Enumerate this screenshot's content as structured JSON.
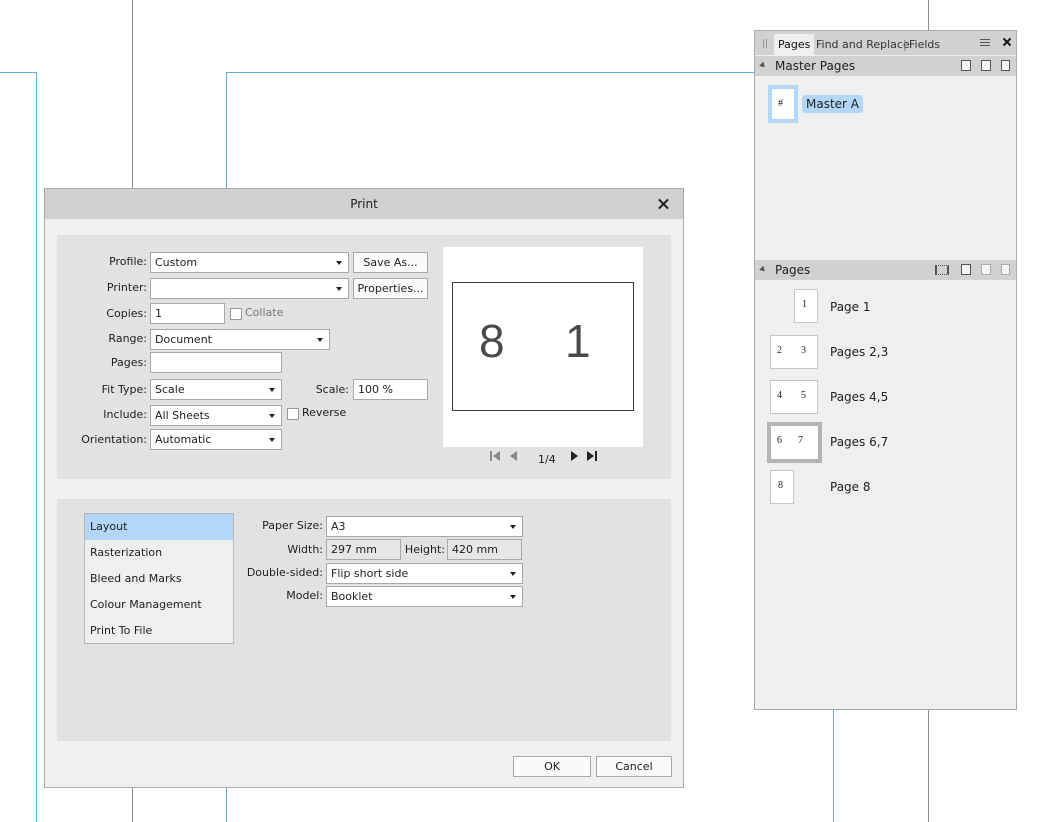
{
  "dialog": {
    "title": "Print",
    "profile": {
      "label": "Profile:",
      "value": "Custom",
      "save_as": "Save As..."
    },
    "printer": {
      "label": "Printer:",
      "value": "",
      "properties": "Properties..."
    },
    "copies": {
      "label": "Copies:",
      "value": "1",
      "collate_label": "Collate"
    },
    "range": {
      "label": "Range:",
      "value": "Document"
    },
    "pages": {
      "label": "Pages:",
      "value": ""
    },
    "fit_type": {
      "label": "Fit Type:",
      "value": "Scale"
    },
    "scale": {
      "label": "Scale:",
      "value": "100 %"
    },
    "include": {
      "label": "Include:",
      "value": "All Sheets",
      "reverse_label": "Reverse"
    },
    "orientation": {
      "label": "Orientation:",
      "value": "Automatic"
    },
    "preview": {
      "left_number": "8",
      "right_number": "1",
      "page_indicator": "1/4"
    },
    "categories": [
      "Layout",
      "Rasterization",
      "Bleed and Marks",
      "Colour Management",
      "Print To File"
    ],
    "paper_size": {
      "label": "Paper Size:",
      "value": "A3"
    },
    "width": {
      "label": "Width:",
      "value": "297 mm"
    },
    "height": {
      "label": "Height:",
      "value": "420 mm"
    },
    "double_sided": {
      "label": "Double-sided:",
      "value": "Flip short side"
    },
    "model": {
      "label": "Model:",
      "value": "Booklet"
    },
    "ok": "OK",
    "cancel": "Cancel"
  },
  "panel": {
    "tabs": [
      "Pages",
      "Find and Replace",
      "Fields"
    ],
    "tab_separator": "|",
    "master_pages_title": "Master Pages",
    "master": {
      "thumb": "#",
      "label": "Master A"
    },
    "pages_title": "Pages",
    "pages": [
      {
        "nums": [
          "1"
        ],
        "label": "Page 1"
      },
      {
        "nums": [
          "2",
          "3"
        ],
        "label": "Pages 2,3"
      },
      {
        "nums": [
          "4",
          "5"
        ],
        "label": "Pages 4,5"
      },
      {
        "nums": [
          "6",
          "7"
        ],
        "label": "Pages 6,7"
      },
      {
        "nums": [
          "8"
        ],
        "label": "Page 8"
      }
    ]
  },
  "colors": {
    "selection": "#b3d7f8",
    "guide": "#5eb2e0",
    "panel_header": "#d1d1d1"
  }
}
